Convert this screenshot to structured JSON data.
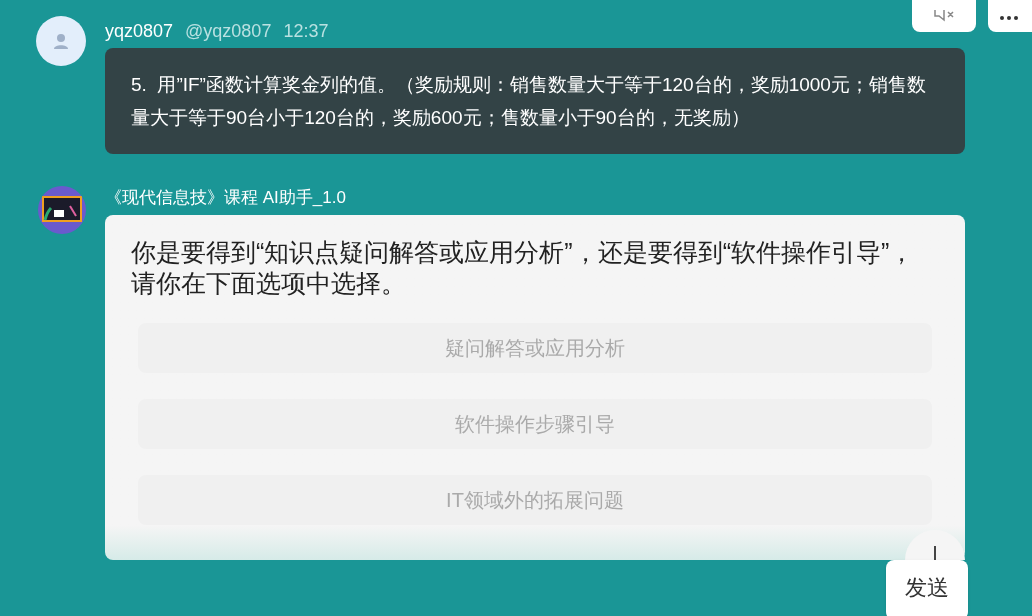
{
  "user_message": {
    "name": "yqz0807",
    "handle": "@yqz0807",
    "time": "12:37",
    "text": "5.  用”IF”函数计算奖金列的值。（奖励规则：销售数量大于等于120台的，奖励1000元；销售数量大于等于90台小于120台的，奖励600元；售数量小于90台的，无奖励）"
  },
  "bot_message": {
    "name": "《现代信息技》课程 AI助手_1.0",
    "text": "你是要得到“知识点疑问解答或应用分析”，还是要得到“软件操作引导”，请你在下面选项中选择。",
    "options": [
      {
        "label": "疑问解答或应用分析"
      },
      {
        "label": "软件操作步骤引导"
      },
      {
        "label": "IT领域外的拓展问题"
      }
    ]
  },
  "send_button": {
    "label": "发送"
  }
}
